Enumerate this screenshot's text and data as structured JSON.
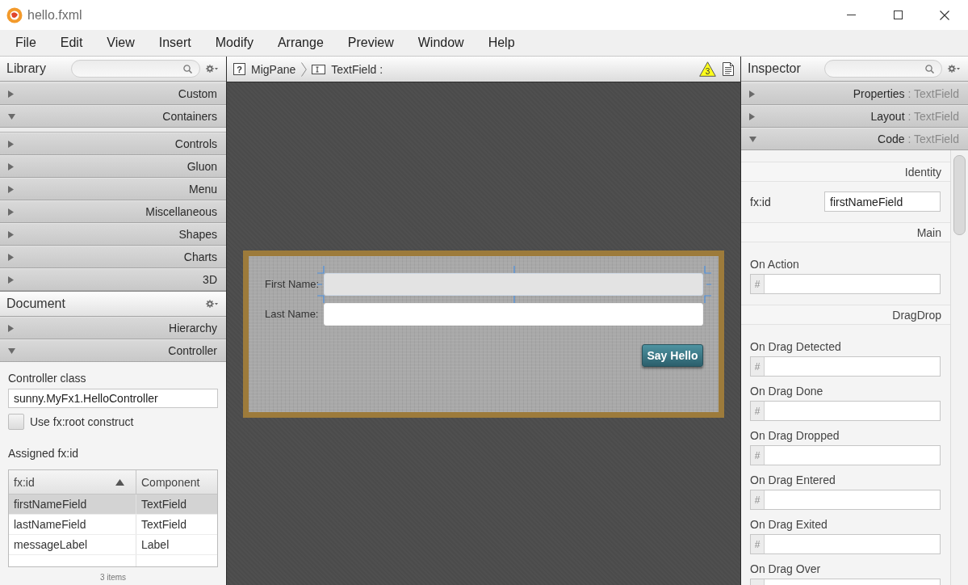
{
  "window": {
    "title": "hello.fxml"
  },
  "menu_bar": [
    "File",
    "Edit",
    "View",
    "Insert",
    "Modify",
    "Arrange",
    "Preview",
    "Window",
    "Help"
  ],
  "library": {
    "title": "Library",
    "sections": [
      {
        "label": "Custom",
        "expanded": false
      },
      {
        "label": "Containers",
        "expanded": true
      },
      {
        "label": "Controls",
        "expanded": false
      },
      {
        "label": "Gluon",
        "expanded": false
      },
      {
        "label": "Menu",
        "expanded": false
      },
      {
        "label": "Miscellaneous",
        "expanded": false
      },
      {
        "label": "Shapes",
        "expanded": false
      },
      {
        "label": "Charts",
        "expanded": false
      },
      {
        "label": "3D",
        "expanded": false
      }
    ]
  },
  "document": {
    "title": "Document",
    "sections": [
      {
        "label": "Hierarchy",
        "expanded": false
      },
      {
        "label": "Controller",
        "expanded": true
      }
    ],
    "controller": {
      "class_label": "Controller class",
      "class_value": "sunny.MyFx1.HelloController",
      "fx_root": {
        "label": "Use fx:root construct",
        "checked": false
      },
      "assigned_label": "Assigned fx:id",
      "table": {
        "columns": [
          {
            "label": "fx:id",
            "sorted_ascending": true
          },
          {
            "label": "Component",
            "sorted_ascending": false
          }
        ],
        "rows": [
          {
            "cells": [
              "firstNameField",
              "TextField"
            ],
            "selected": true
          },
          {
            "cells": [
              "lastNameField",
              "TextField"
            ],
            "selected": false
          },
          {
            "cells": [
              "messageLabel",
              "Label"
            ],
            "selected": false
          }
        ]
      },
      "item_count": "3 items"
    }
  },
  "breadcrumb": {
    "items": [
      {
        "kind": "unknown",
        "icon_text": "?",
        "label": "MigPane"
      },
      {
        "kind": "text_field",
        "label": "TextField :"
      }
    ],
    "warning_count": "3"
  },
  "canvas": {
    "form": {
      "rows": [
        {
          "label": "First Name:",
          "selected": true
        },
        {
          "label": "Last Name:",
          "selected": false
        }
      ],
      "button": "Say Hello"
    }
  },
  "inspector": {
    "title": "Inspector",
    "sections": [
      {
        "label": "Properties",
        "detail": ": TextField",
        "expanded": false
      },
      {
        "label": "Layout",
        "detail": ": TextField",
        "expanded": false
      },
      {
        "label": "Code",
        "detail": ": TextField",
        "expanded": true
      }
    ],
    "groups": [
      {
        "title": "Identity",
        "fields": [
          {
            "kind": "text",
            "label": "fx:id",
            "value": "firstNameField"
          }
        ]
      },
      {
        "title": "Main",
        "fields": [
          {
            "kind": "handler",
            "label": "On Action",
            "prefix": "#"
          }
        ]
      },
      {
        "title": "DragDrop",
        "fields": [
          {
            "kind": "handler",
            "label": "On Drag Detected",
            "prefix": "#"
          },
          {
            "kind": "handler",
            "label": "On Drag Done",
            "prefix": "#"
          },
          {
            "kind": "handler",
            "label": "On Drag Dropped",
            "prefix": "#"
          },
          {
            "kind": "handler",
            "label": "On Drag Entered",
            "prefix": "#"
          },
          {
            "kind": "handler",
            "label": "On Drag Exited",
            "prefix": "#"
          },
          {
            "kind": "handler",
            "label": "On Drag Over"
          }
        ]
      }
    ]
  }
}
